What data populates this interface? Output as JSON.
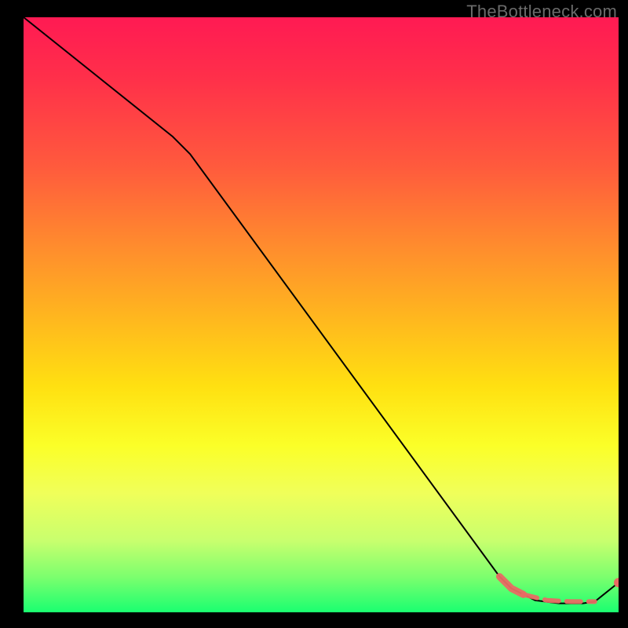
{
  "watermark": "TheBottleneck.com",
  "colors": {
    "background": "#000000",
    "line": "#000000",
    "accent": "#e96a63"
  },
  "chart_data": {
    "type": "line",
    "title": "",
    "xlabel": "",
    "ylabel": "",
    "xlim": [
      0,
      100
    ],
    "ylim": [
      0,
      100
    ],
    "grid": false,
    "legend": false,
    "series": [
      {
        "name": "main-curve",
        "x": [
          0,
          25,
          28,
          80,
          82,
          86,
          90,
          94,
          96,
          100
        ],
        "y": [
          100,
          80,
          77,
          6,
          4,
          2,
          1.5,
          1.5,
          1.8,
          5
        ],
        "style": "solid-black"
      },
      {
        "name": "fit-segment-steep",
        "x": [
          80,
          82,
          84
        ],
        "y": [
          6,
          4,
          3
        ],
        "style": "thick-accent-solid"
      },
      {
        "name": "fit-segment-flat",
        "x": [
          84,
          88,
          92,
          96
        ],
        "y": [
          3,
          2,
          1.8,
          1.8
        ],
        "style": "thick-accent-dashed"
      },
      {
        "name": "fit-endpoint",
        "x": [
          100
        ],
        "y": [
          5
        ],
        "style": "accent-dot"
      }
    ]
  }
}
